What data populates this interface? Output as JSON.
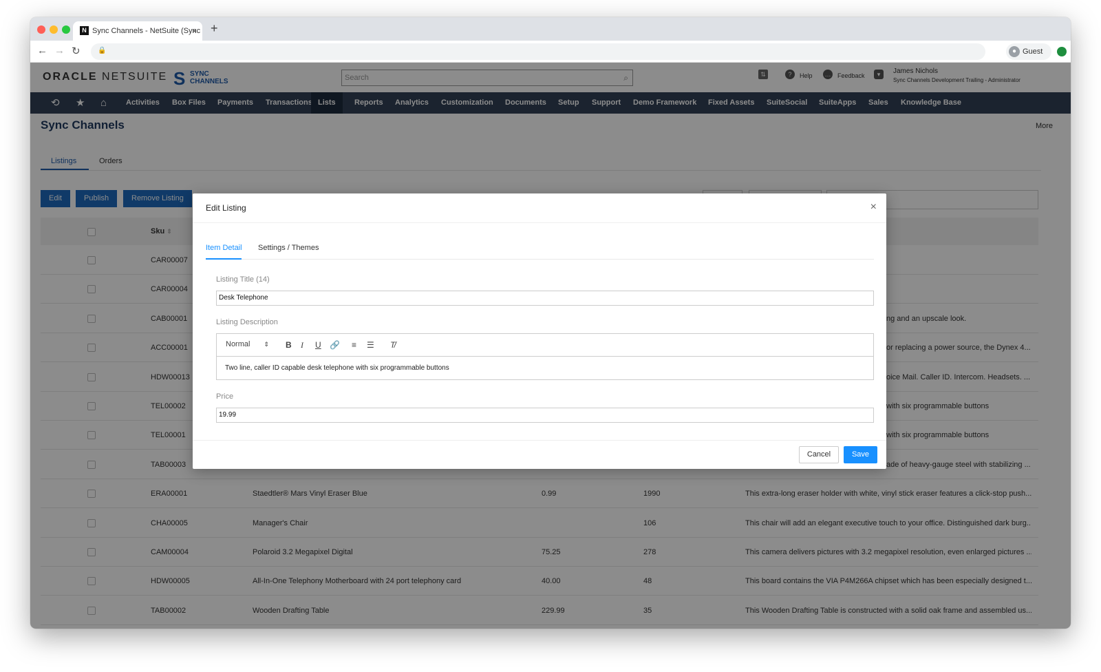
{
  "browser": {
    "tab_title": "Sync Channels - NetSuite (Sync Channels Development Trailing)",
    "new_tab": "+",
    "close": "×",
    "guest": "Guest"
  },
  "header": {
    "brand_oracle": "ORACLE",
    "brand_netsuite": "NETSUITE",
    "sync_line1": "SYNC",
    "sync_line2": "CHANNELS",
    "search_placeholder": "Search",
    "help": "Help",
    "feedback": "Feedback",
    "user_name": "James Nichols",
    "user_role": "Sync Channels Development Trailing - Administrator"
  },
  "menu": [
    "Activities",
    "Box Files",
    "Payments",
    "Transactions",
    "Lists",
    "Reports",
    "Analytics",
    "Customization",
    "Documents",
    "Setup",
    "Support",
    "Demo Framework",
    "Fixed Assets",
    "SuiteSocial",
    "SuiteApps",
    "Sales",
    "Knowledge Base"
  ],
  "menu_active": "Lists",
  "page": {
    "title": "Sync Channels",
    "more": "More",
    "tabs": [
      "Listings",
      "Orders"
    ],
    "buttons": {
      "edit": "Edit",
      "publish": "Publish",
      "remove": "Remove Listing"
    },
    "sku_header": "Sku"
  },
  "rows": [
    {
      "sku": "CAR00007",
      "name": "",
      "price": "",
      "qty": "",
      "desc": ""
    },
    {
      "sku": "CAR00004",
      "name": "",
      "price": "",
      "qty": "",
      "desc": ""
    },
    {
      "sku": "CAB00001",
      "name": "",
      "price": "",
      "qty": "",
      "desc": "ng and an upscale look."
    },
    {
      "sku": "ACC00001",
      "name": "",
      "price": "",
      "qty": "",
      "desc": "or replacing a power source, the Dynex 4..."
    },
    {
      "sku": "HDW00013",
      "name": "",
      "price": "",
      "qty": "",
      "desc": "oice Mail. Caller ID. Intercom. Headsets. ..."
    },
    {
      "sku": "TEL00002",
      "name": "",
      "price": "",
      "qty": "",
      "desc": "with six programmable buttons"
    },
    {
      "sku": "TEL00001",
      "name": "",
      "price": "",
      "qty": "",
      "desc": "with six programmable buttons"
    },
    {
      "sku": "TAB00003",
      "name": "",
      "price": "",
      "qty": "",
      "desc": "ade of heavy-gauge steel with stabilizing ..."
    },
    {
      "sku": "ERA00001",
      "name": "Staedtler® Mars Vinyl Eraser Blue",
      "price": "0.99",
      "qty": "1990",
      "desc": "This extra-long eraser holder with white, vinyl stick eraser features a click-stop push..."
    },
    {
      "sku": "CHA00005",
      "name": "Manager's Chair",
      "price": "",
      "qty": "106",
      "desc": "This chair will add an elegant executive touch to your office. Distinguished dark burg..."
    },
    {
      "sku": "CAM00004",
      "name": "Polaroid 3.2 Megapixel Digital",
      "price": "75.25",
      "qty": "278",
      "desc": "This camera delivers pictures with 3.2 megapixel resolution, even enlarged pictures ..."
    },
    {
      "sku": "HDW00005",
      "name": "All-In-One Telephony Motherboard with 24 port telephony card",
      "price": "40.00",
      "qty": "48",
      "desc": "This board contains the VIA P4M266A chipset which has been especially designed t..."
    },
    {
      "sku": "TAB00002",
      "name": "Wooden Drafting Table",
      "price": "229.99",
      "qty": "35",
      "desc": "This Wooden Drafting Table is constructed with a solid oak frame and assembled us..."
    }
  ],
  "modal": {
    "title": "Edit Listing",
    "close": "×",
    "tabs": [
      "Item Detail",
      "Settings / Themes"
    ],
    "title_label": "Listing Title (14)",
    "title_value": "Desk Telephone",
    "desc_label": "Listing Description",
    "format_select": "Normal",
    "desc_value": "Two line, caller ID capable desk telephone with six programmable buttons",
    "price_label": "Price",
    "price_value": "19.99",
    "cancel": "Cancel",
    "save": "Save"
  },
  "colors": {
    "menubar": "#324157",
    "primary": "#1e6bbd",
    "save": "#1890ff"
  }
}
